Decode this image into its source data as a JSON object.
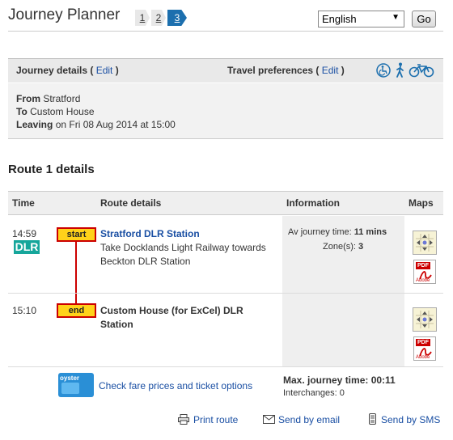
{
  "header": {
    "title": "Journey Planner",
    "steps": [
      "1",
      "2",
      "3"
    ],
    "language": "English",
    "go_label": "Go"
  },
  "journey": {
    "details_label": "Journey details",
    "edit_label": "Edit",
    "prefs_label": "Travel preferences",
    "from_label": "From",
    "from_value": "Stratford",
    "to_label": "To",
    "to_value": "Custom House",
    "leaving_label": "Leaving",
    "leaving_value": "on Fri 08 Aug 2014 at 15:00"
  },
  "route": {
    "title": "Route 1 details",
    "columns": [
      "Time",
      "Route details",
      "Information",
      "Maps"
    ],
    "legs": [
      {
        "time": "14:59",
        "mode": "DLR",
        "badge": "start",
        "station": "Stratford DLR Station",
        "instruction": "Take Docklands Light Railway towards Beckton DLR Station",
        "av_label": "Av journey time:",
        "av_value": "11 mins",
        "zone_label": "Zone(s):",
        "zone_value": "3"
      },
      {
        "time": "15:10",
        "badge": "end",
        "station": "Custom House (for ExCel) DLR Station"
      }
    ],
    "fare": {
      "card_label": "oyster",
      "link": "Check fare prices and ticket options",
      "max_label": "Max. journey time: 00:11",
      "interchanges": "Interchanges: 0"
    }
  },
  "footer": {
    "print": "Print route",
    "email": "Send by email",
    "sms": "Send by SMS"
  },
  "icons": {
    "pdf_label": "PDF",
    "adobe_label": "Adobe"
  },
  "colors": {
    "link": "#1a4fa3",
    "dlr": "#16a69b",
    "badge": "#ffd21a",
    "badge_border": "#cc0000",
    "step_active": "#1c6fae"
  }
}
